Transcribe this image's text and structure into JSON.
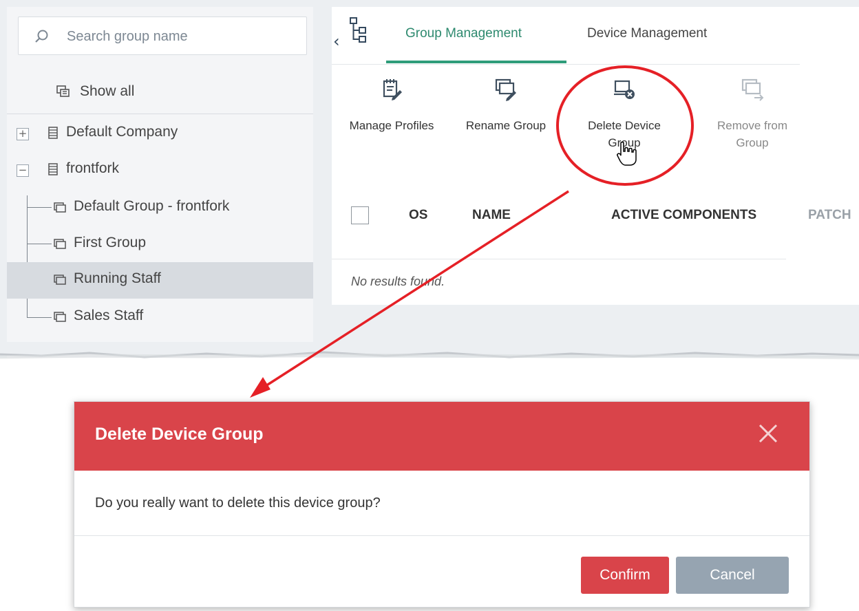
{
  "colors": {
    "accent_green": "#2e8a6f",
    "danger_red": "#d9444a",
    "annotation_red": "#e52026",
    "cancel_gray": "#96a4b1"
  },
  "sidebar": {
    "search_placeholder": "Search group name",
    "search_icon": "search-icon",
    "show_all_label": "Show all",
    "tree": [
      {
        "label": "Default Company",
        "icon": "company-icon",
        "toggle": "+"
      },
      {
        "label": "frontfork",
        "icon": "company-icon",
        "toggle": "−"
      },
      {
        "label": "Default Group - frontfork",
        "icon": "device-group-icon"
      },
      {
        "label": "First Group",
        "icon": "device-group-icon"
      },
      {
        "label": "Running Staff",
        "icon": "device-group-icon",
        "selected": true
      },
      {
        "label": "Sales Staff",
        "icon": "device-group-icon"
      }
    ]
  },
  "main": {
    "collapse_chevron": "‹",
    "tabs": [
      {
        "label": "Group Management",
        "active": true
      },
      {
        "label": "Device Management",
        "active": false
      }
    ],
    "toolbar": [
      {
        "label": "Manage Profiles",
        "icon": "manage-profiles-icon"
      },
      {
        "label": "Rename Group",
        "icon": "rename-group-icon"
      },
      {
        "label": "Delete Device Group",
        "icon": "delete-device-group-icon"
      },
      {
        "label": "Remove from Group",
        "icon": "remove-from-group-icon",
        "disabled": true
      }
    ],
    "table": {
      "columns": [
        "OS",
        "NAME",
        "ACTIVE COMPONENTS",
        "PATCH"
      ],
      "empty_text": "No results found."
    }
  },
  "dialog": {
    "title": "Delete Device Group",
    "message": "Do you really want to delete this device group?",
    "confirm_label": "Confirm",
    "cancel_label": "Cancel"
  }
}
